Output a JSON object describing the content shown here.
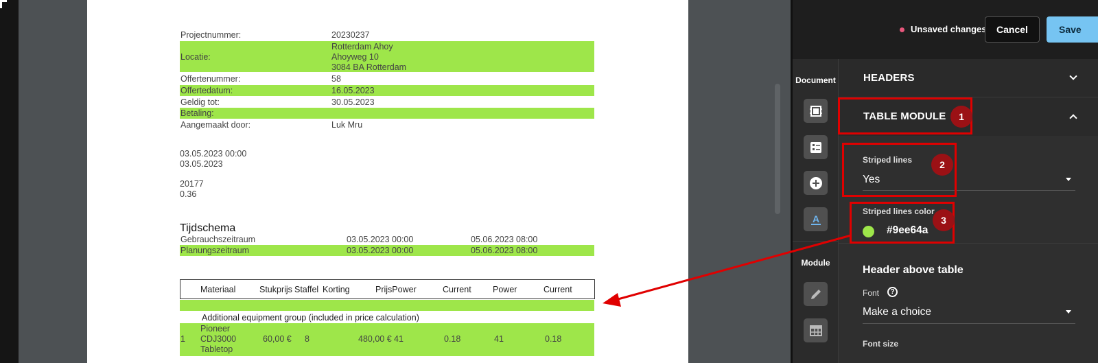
{
  "document": {
    "info_rows": [
      {
        "label": "Projectnummer:",
        "value": "20230237"
      },
      {
        "label": "Locatie:",
        "value_lines": [
          "Rotterdam Ahoy",
          "Ahoyweg 10",
          "3084 BA Rotterdam"
        ]
      },
      {
        "label": "Offertenummer:",
        "value": "58"
      },
      {
        "label": "Offertedatum:",
        "value": "16.05.2023"
      },
      {
        "label": "Geldig tot:",
        "value": "30.05.2023"
      },
      {
        "label": "Betaling:",
        "value": ""
      },
      {
        "label": "Aangemaakt door:",
        "value": "Luk Mru"
      }
    ],
    "free_lines": [
      "03.05.2023 00:00",
      "03.05.2023",
      "20177",
      "0.36"
    ],
    "schedule": {
      "heading": "Tijdschema",
      "rows": [
        {
          "name": "Gebrauchszeitraum",
          "start": "03.05.2023 00:00",
          "end": "05.06.2023 08:00"
        },
        {
          "name": "Planungszeitraum",
          "start": "03.05.2023 00:00",
          "end": "05.06.2023 08:00"
        }
      ]
    },
    "table": {
      "headers": [
        "Materiaal",
        "Stukprijs",
        "Staffel",
        "Korting",
        "PrijsPower",
        "Current",
        "Power",
        "Current"
      ],
      "group_label": "Additional equipment group (included in price calculation)",
      "row": {
        "index": "1",
        "name_lines": [
          "Pioneer",
          "CDJ3000",
          "Tabletop"
        ],
        "unit_price": "60,00 €",
        "staffel": "8",
        "price": "480,00 €",
        "power": "41",
        "current": "0.18",
        "power2": "41",
        "current2": "0.18"
      }
    }
  },
  "topbar": {
    "unsaved_label": "Unsaved changes",
    "cancel_label": "Cancel",
    "save_label": "Save"
  },
  "rail": {
    "document_label": "Document",
    "module_label": "Module",
    "icons": [
      "layout-icon",
      "list-icon",
      "add-icon",
      "text-color-icon",
      "pencil-icon",
      "table-icon"
    ]
  },
  "settings": {
    "headers_title": "HEADERS",
    "table_module_title": "TABLE MODULE",
    "striped_lines_label": "Striped lines",
    "striped_lines_value": "Yes",
    "striped_color_label": "Striped lines color",
    "striped_color_value": "#9ee64a",
    "striped_color_hex_text": "#9ee64a",
    "header_above_table_title": "Header above table",
    "font_label": "Font",
    "font_value": "Make a choice",
    "font_size_label": "Font size"
  },
  "annotations": {
    "badges": [
      "1",
      "2",
      "3"
    ],
    "color": "#e00000"
  },
  "colors": {
    "stripe": "#9ee64a",
    "save_button": "#76c4f2",
    "unsaved_dot": "#e8577c"
  }
}
